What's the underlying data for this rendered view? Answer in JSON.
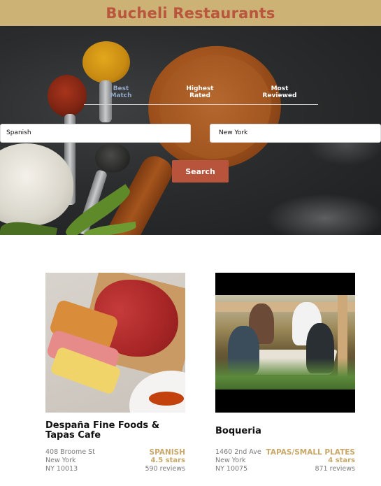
{
  "header": {
    "title": "Bucheli Restaurants"
  },
  "sort_options": [
    {
      "label_line1": "Best",
      "label_line2": "Match",
      "active": true
    },
    {
      "label_line1": "Highest",
      "label_line2": "Rated",
      "active": false
    },
    {
      "label_line1": "Most",
      "label_line2": "Reviewed",
      "active": false
    }
  ],
  "search": {
    "term_value": "Spanish",
    "location_value": "New York",
    "button_label": "Search"
  },
  "businesses": [
    {
      "name": "Despaña Fine Foods & Tapas Cafe",
      "address": "408 Broome St",
      "city": "New York",
      "state_zip": "NY 10013",
      "category": "SPANISH",
      "rating": "4.5 stars",
      "review_count": "590 reviews"
    },
    {
      "name": "Boqueria",
      "address": "1460 2nd Ave",
      "city": "New York",
      "state_zip": "NY 10075",
      "category": "TAPAS/SMALL PLATES",
      "rating": "4 stars",
      "review_count": "871 reviews"
    }
  ],
  "colors": {
    "header_bg": "#cdb275",
    "brand_text": "#b9563d",
    "button_bg": "#b9543c",
    "accent_gold": "#c8a86a",
    "active_tab": "#93a8c8"
  }
}
